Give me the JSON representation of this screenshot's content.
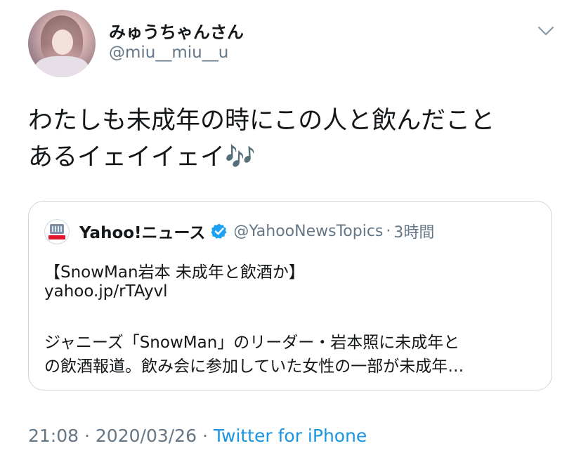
{
  "author": {
    "display_name": "みゅうちゃんさん",
    "handle": "@miu__miu__u"
  },
  "tweet": {
    "text": "わたしも未成年の時にこの人と飲んだこと\nあるイェイイェイ🎶"
  },
  "quoted_tweet": {
    "name": "Yahoo!ニュース",
    "handle": "@YahooNewsTopics",
    "separator": "·",
    "time": "3時間",
    "headline": "【SnowMan岩本 未成年と飲酒か】",
    "link": "yahoo.jp/rTAyvl",
    "summary": "ジャニーズ「SnowMan」のリーダー・岩本照に未成年と\nの飲酒報道。飲み会に参加していた女性の一部が未成年…"
  },
  "meta": {
    "time": "21:08",
    "separator1": "·",
    "date": "2020/03/26",
    "separator2": "·",
    "source": "Twitter for iPhone"
  },
  "colors": {
    "text": "#14171a",
    "secondary": "#657786",
    "link": "#1b95e0",
    "border": "#ccd6dd",
    "verified": "#1da1f2"
  },
  "icons": {
    "menu": "chevron-down-icon",
    "verified": "verified-badge-icon"
  }
}
